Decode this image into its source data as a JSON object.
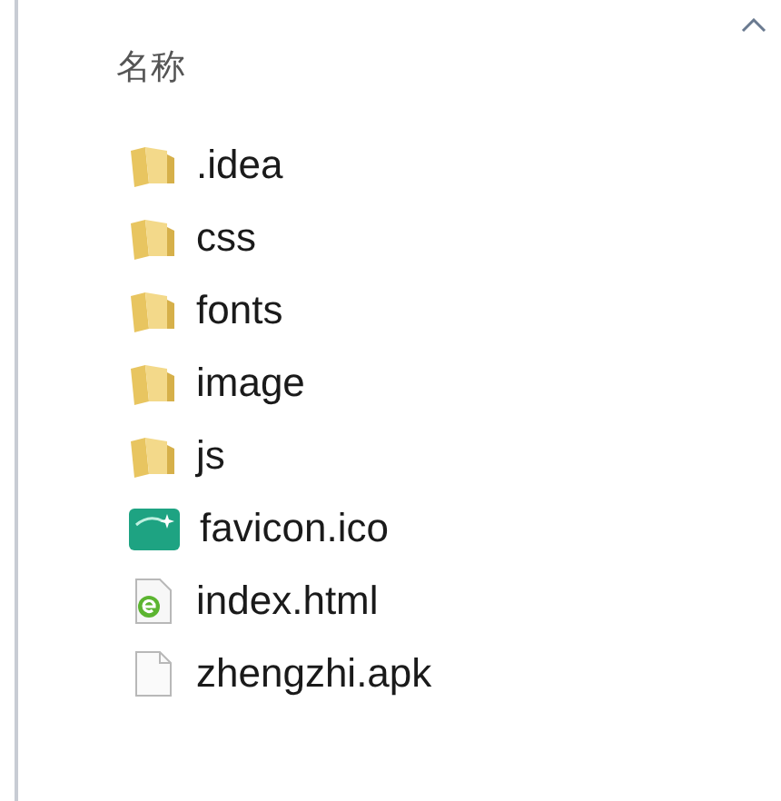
{
  "column_header": "名称",
  "files": [
    {
      "name": ".idea",
      "kind": "folder"
    },
    {
      "name": "css",
      "kind": "folder"
    },
    {
      "name": "fonts",
      "kind": "folder"
    },
    {
      "name": "image",
      "kind": "folder"
    },
    {
      "name": "js",
      "kind": "folder"
    },
    {
      "name": "favicon.ico",
      "kind": "ico"
    },
    {
      "name": "index.html",
      "kind": "html"
    },
    {
      "name": "zhengzhi.apk",
      "kind": "file"
    }
  ]
}
